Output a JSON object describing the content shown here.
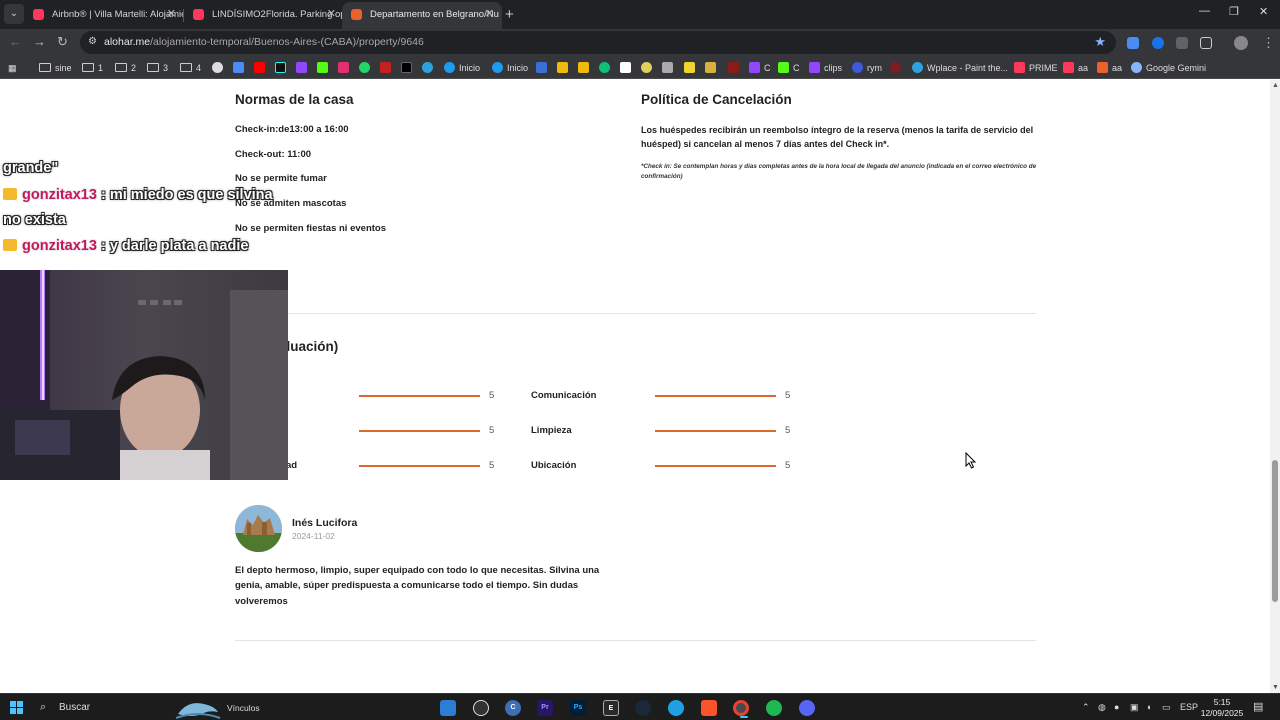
{
  "browser": {
    "tabs": [
      {
        "title": "Airbnb® | Villa Martelli: Alojamie",
        "favicon_color": "#ff385c"
      },
      {
        "title": "LINDÍSIMO2Florida. Parking op",
        "favicon_color": "#ff385c"
      },
      {
        "title": "Departamento en Belgrano/Nu",
        "favicon_color": "#e8632b"
      }
    ],
    "url_host": "alohar.me",
    "url_path": "/alojamiento-temporal/Buenos-Aires-(CABA)/property/9646",
    "bookmarks": [
      {
        "label": "sine",
        "kind": "folder"
      },
      {
        "label": "1",
        "kind": "folder"
      },
      {
        "label": "2",
        "kind": "folder"
      },
      {
        "label": "3",
        "kind": "folder"
      },
      {
        "label": "4",
        "kind": "folder"
      },
      {
        "label": "Inicio",
        "kind": "site",
        "color": "#1d9bf0"
      },
      {
        "label": "Inicio",
        "kind": "site",
        "color": "#1d9bf0"
      },
      {
        "label": "C",
        "kind": "site",
        "color": "#9146ff"
      },
      {
        "label": "C",
        "kind": "site",
        "color": "#53fc18"
      },
      {
        "label": "clips",
        "kind": "site",
        "color": "#9146ff"
      },
      {
        "label": "rym",
        "kind": "site",
        "color": "#3b5bdb"
      },
      {
        "label": "Wplace - Paint the...",
        "kind": "site",
        "color": "#2aa3e0"
      },
      {
        "label": "PRIME",
        "kind": "site",
        "color": "#ff385c"
      },
      {
        "label": "aa",
        "kind": "site",
        "color": "#ff385c"
      },
      {
        "label": "aa",
        "kind": "site",
        "color": "#e8632b"
      },
      {
        "label": "Google Gemini",
        "kind": "site",
        "color": "#8ab4f8"
      }
    ]
  },
  "house_rules": {
    "title": "Normas de la casa",
    "items": [
      "Check-in:de13:00 a 16:00",
      "Check-out: 11:00",
      "No se permite fumar",
      "No se admiten mascotas",
      "No se permiten fiestas ni eventos"
    ]
  },
  "cancellation": {
    "title": "Política de Cancelación",
    "text": "Los huéspedes recibirán un reembolso íntegro de la reserva (menos la tarifa de servicio del huésped) si cancelan al menos 7 días antes del Check in*.",
    "note": "*Check in: Se contemplan horas y días completas antes de la hora local de llegada del anuncio (indicada en el correo electrónico de confirmación)"
  },
  "reviews": {
    "title_visible": "aluación)",
    "ratings_left": [
      {
        "label": "",
        "value": 5,
        "max": 5
      },
      {
        "label": "",
        "value": 5,
        "max": 5
      },
      {
        "label": "ad",
        "value": 5,
        "max": 5
      }
    ],
    "ratings_right": [
      {
        "label": "Comunicación",
        "value": 5,
        "max": 5
      },
      {
        "label": "Limpieza",
        "value": 5,
        "max": 5
      },
      {
        "label": "Ubicación",
        "value": 5,
        "max": 5
      }
    ],
    "review": {
      "name": "Inés Lucifora",
      "date": "2024-11-02",
      "text": "El depto hermoso, limpio, super equipado con todo lo que necesitas. Silvina una genia, amable, súper predispuesta a comunicarse todo el tiempo. Sin dudas volveremos"
    }
  },
  "stream_chat": [
    {
      "user": "",
      "message": "grande\""
    },
    {
      "user": "gonzitax13",
      "message": ": mi miedo es que silvina"
    },
    {
      "user": "",
      "message": "no exista"
    },
    {
      "user": "gonzitax13",
      "message": ": y darle plata a nadie"
    }
  ],
  "taskbar": {
    "search_placeholder": "Buscar",
    "vinculos": "Vínculos",
    "language": "ESP",
    "time": "5:15",
    "date": "12/09/2025"
  },
  "colors": {
    "accent": "#d96a2b",
    "chrome_dark": "#202124",
    "chat_username": "#c2185b"
  }
}
